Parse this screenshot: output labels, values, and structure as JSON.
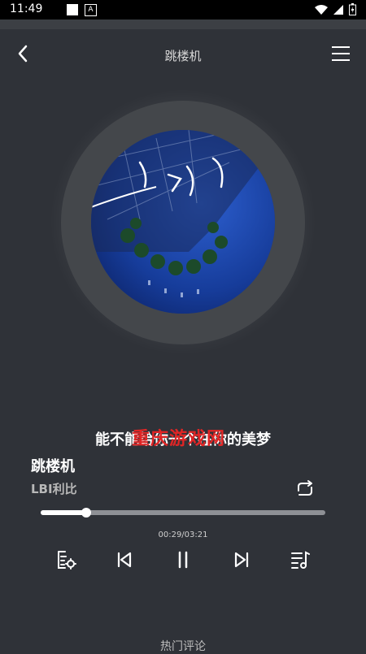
{
  "status": {
    "time": "11:49",
    "notif_icon_letter": "A"
  },
  "header": {
    "title": "跳楼机"
  },
  "song": {
    "name": "跳楼机",
    "artist": "LBI利比"
  },
  "lyric": {
    "text": "能不能给你一个在你的美梦",
    "watermark": "重庆游戏网"
  },
  "playback": {
    "elapsed": "00:29",
    "duration": "03:21",
    "time_text": "00:29/03:21",
    "progress": 0.16
  },
  "footer": {
    "hot_comments": "热门评论"
  },
  "colors": {
    "background": "#2f3238",
    "accent_watermark": "#e02525",
    "progress_fill": "#ffffff",
    "progress_track": "#8e9095"
  }
}
